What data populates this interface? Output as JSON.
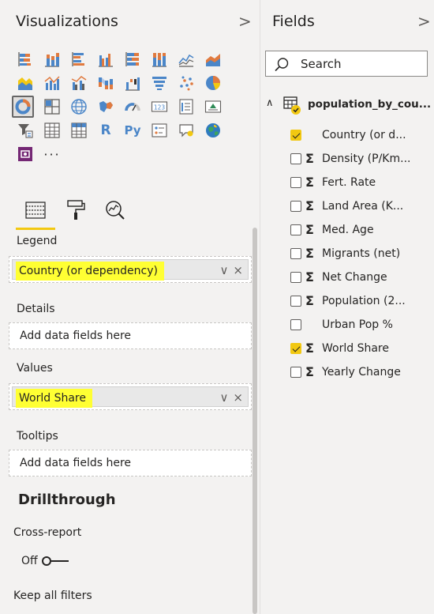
{
  "visualizations": {
    "title": "Visualizations",
    "chevron": ">",
    "more": "···",
    "gallery_text": {
      "r": "R",
      "py": "Py",
      "num": "123"
    },
    "subtabs": [
      "fields-tab",
      "format-tab",
      "analytics-tab"
    ]
  },
  "wells": {
    "legend": {
      "label": "Legend",
      "field": "Country (or dependency)"
    },
    "details": {
      "label": "Details",
      "placeholder": "Add data fields here"
    },
    "values": {
      "label": "Values",
      "field": "World Share"
    },
    "tooltips": {
      "label": "Tooltips",
      "placeholder": "Add data fields here"
    },
    "chip_actions": {
      "expand": "∨",
      "remove": "×"
    }
  },
  "drillthrough": {
    "title": "Drillthrough",
    "cross_report_label": "Cross-report",
    "toggle_state": "Off",
    "keep_filters_label": "Keep all filters"
  },
  "fields": {
    "title": "Fields",
    "chevron": ">",
    "search_placeholder": "Search",
    "table": {
      "chevron": "∧",
      "name": "population_by_cou..."
    },
    "items": [
      {
        "label": "Country (or d...",
        "checked": true,
        "sigma": false
      },
      {
        "label": "Density (P/Km...",
        "checked": false,
        "sigma": true
      },
      {
        "label": "Fert. Rate",
        "checked": false,
        "sigma": true
      },
      {
        "label": "Land Area (K...",
        "checked": false,
        "sigma": true
      },
      {
        "label": "Med. Age",
        "checked": false,
        "sigma": true
      },
      {
        "label": "Migrants (net)",
        "checked": false,
        "sigma": true
      },
      {
        "label": "Net Change",
        "checked": false,
        "sigma": true
      },
      {
        "label": "Population (2...",
        "checked": false,
        "sigma": true
      },
      {
        "label": "Urban Pop %",
        "checked": false,
        "sigma": false
      },
      {
        "label": "World Share",
        "checked": true,
        "sigma": true
      },
      {
        "label": "Yearly Change",
        "checked": false,
        "sigma": true
      }
    ],
    "sigma_symbol": "Σ"
  },
  "colors": {
    "accent": "#f2c811",
    "highlight": "#ffff33",
    "pane_bg": "#f3f2f1",
    "chart_blue": "#4b86c8",
    "chart_orange": "#e07a3f"
  }
}
